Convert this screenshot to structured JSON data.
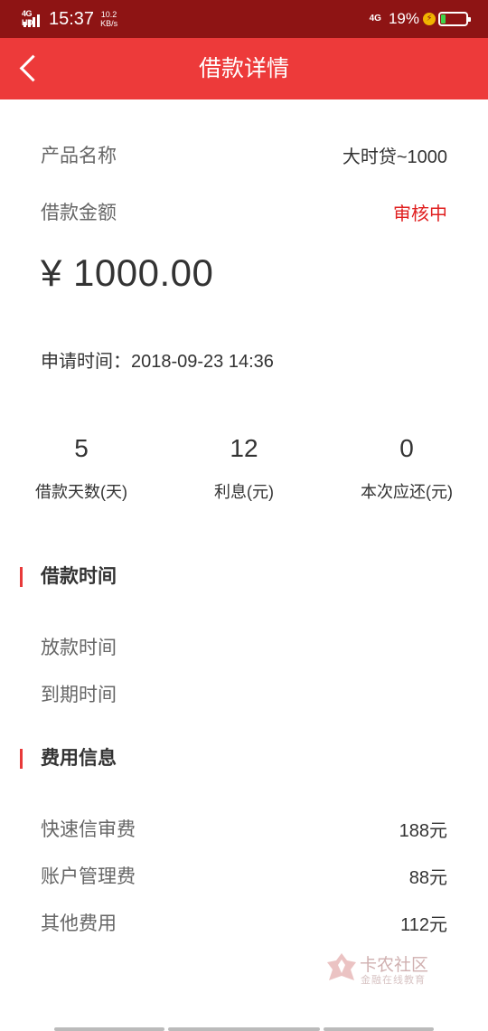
{
  "status_bar": {
    "network_tag": "4G HD",
    "time": "15:37",
    "speed_value": "10.2",
    "speed_unit": "KB/s",
    "network_right": "4G",
    "battery_percent": "19%",
    "battery_level": 0.19,
    "charging_icon": "bolt-icon"
  },
  "navbar": {
    "back_icon": "chevron-left-icon",
    "title": "借款详情"
  },
  "details": {
    "product_label": "产品名称",
    "product_value": "大时贷~1000",
    "amount_label": "借款金额",
    "status": "审核中",
    "amount": "¥ 1000.00",
    "apply_time": "申请时间：2018-09-23 14:36"
  },
  "stats": [
    {
      "value": "5",
      "label": "借款天数(天)"
    },
    {
      "value": "12",
      "label": "利息(元)"
    },
    {
      "value": "0",
      "label": "本次应还(元)"
    }
  ],
  "loan_time": {
    "title": "借款时间",
    "release_label": "放款时间",
    "due_label": "到期时间"
  },
  "fees": {
    "title": "费用信息",
    "items": [
      {
        "label": "快速信审费",
        "value": "188元"
      },
      {
        "label": "账户管理费",
        "value": "88元"
      },
      {
        "label": "其他费用",
        "value": "112元"
      }
    ]
  },
  "watermark": {
    "main": "卡农社区",
    "sub": "金融在线教育",
    "color": "#d9b3b3"
  },
  "colors": {
    "status_bar_bg": "#8e1414",
    "header_bg": "#ed3a3a",
    "accent_red": "#e02020",
    "battery_fill": "#3fd34a"
  }
}
